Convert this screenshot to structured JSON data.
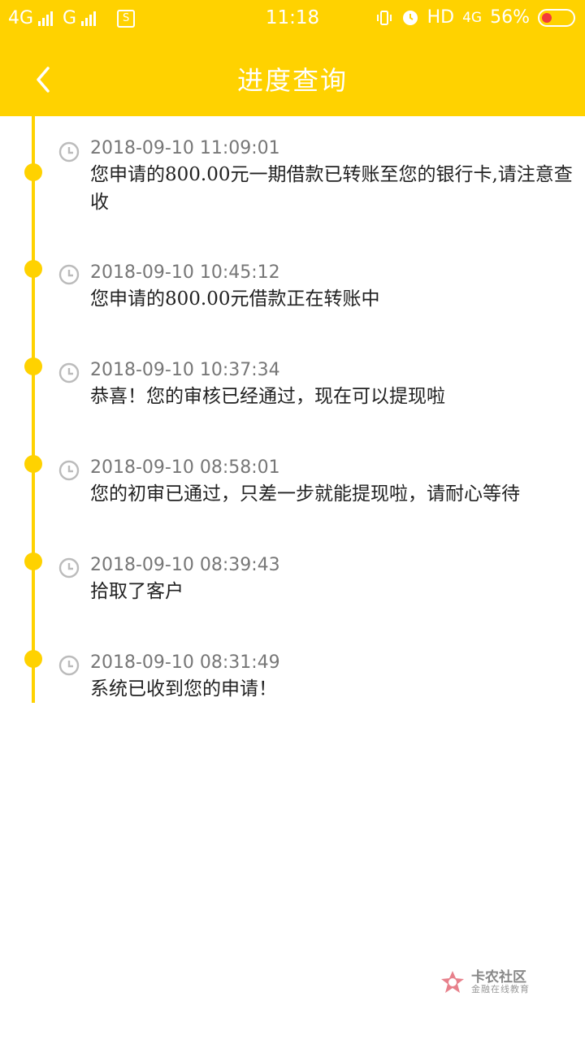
{
  "status_bar": {
    "network_1": "4G",
    "network_2": "G",
    "sim_icon_label": "S",
    "time": "11:18",
    "hd_label": "HD",
    "data_label": "4G",
    "battery_percent": "56%"
  },
  "header": {
    "title": "进度查询",
    "back_icon": "chevron-left-icon"
  },
  "timeline": {
    "items": [
      {
        "time": "2018-09-10 11:09:01",
        "text": "您申请的800.00元一期借款已转账至您的银行卡,请注意查收"
      },
      {
        "time": "2018-09-10 10:45:12",
        "text": "您申请的800.00元借款正在转账中"
      },
      {
        "time": "2018-09-10 10:37:34",
        "text": "恭喜！您的审核已经通过，现在可以提现啦"
      },
      {
        "time": "2018-09-10 08:58:01",
        "text": "您的初审已通过，只差一步就能提现啦，请耐心等待"
      },
      {
        "time": "2018-09-10 08:39:43",
        "text": "拾取了客户"
      },
      {
        "time": "2018-09-10 08:31:49",
        "text": "系统已收到您的申请！"
      }
    ]
  },
  "watermark": {
    "main": "卡农社区",
    "sub": "金融在线教育"
  },
  "colors": {
    "accent": "#FFD200",
    "time_text": "#777777",
    "body_text": "#222222"
  }
}
